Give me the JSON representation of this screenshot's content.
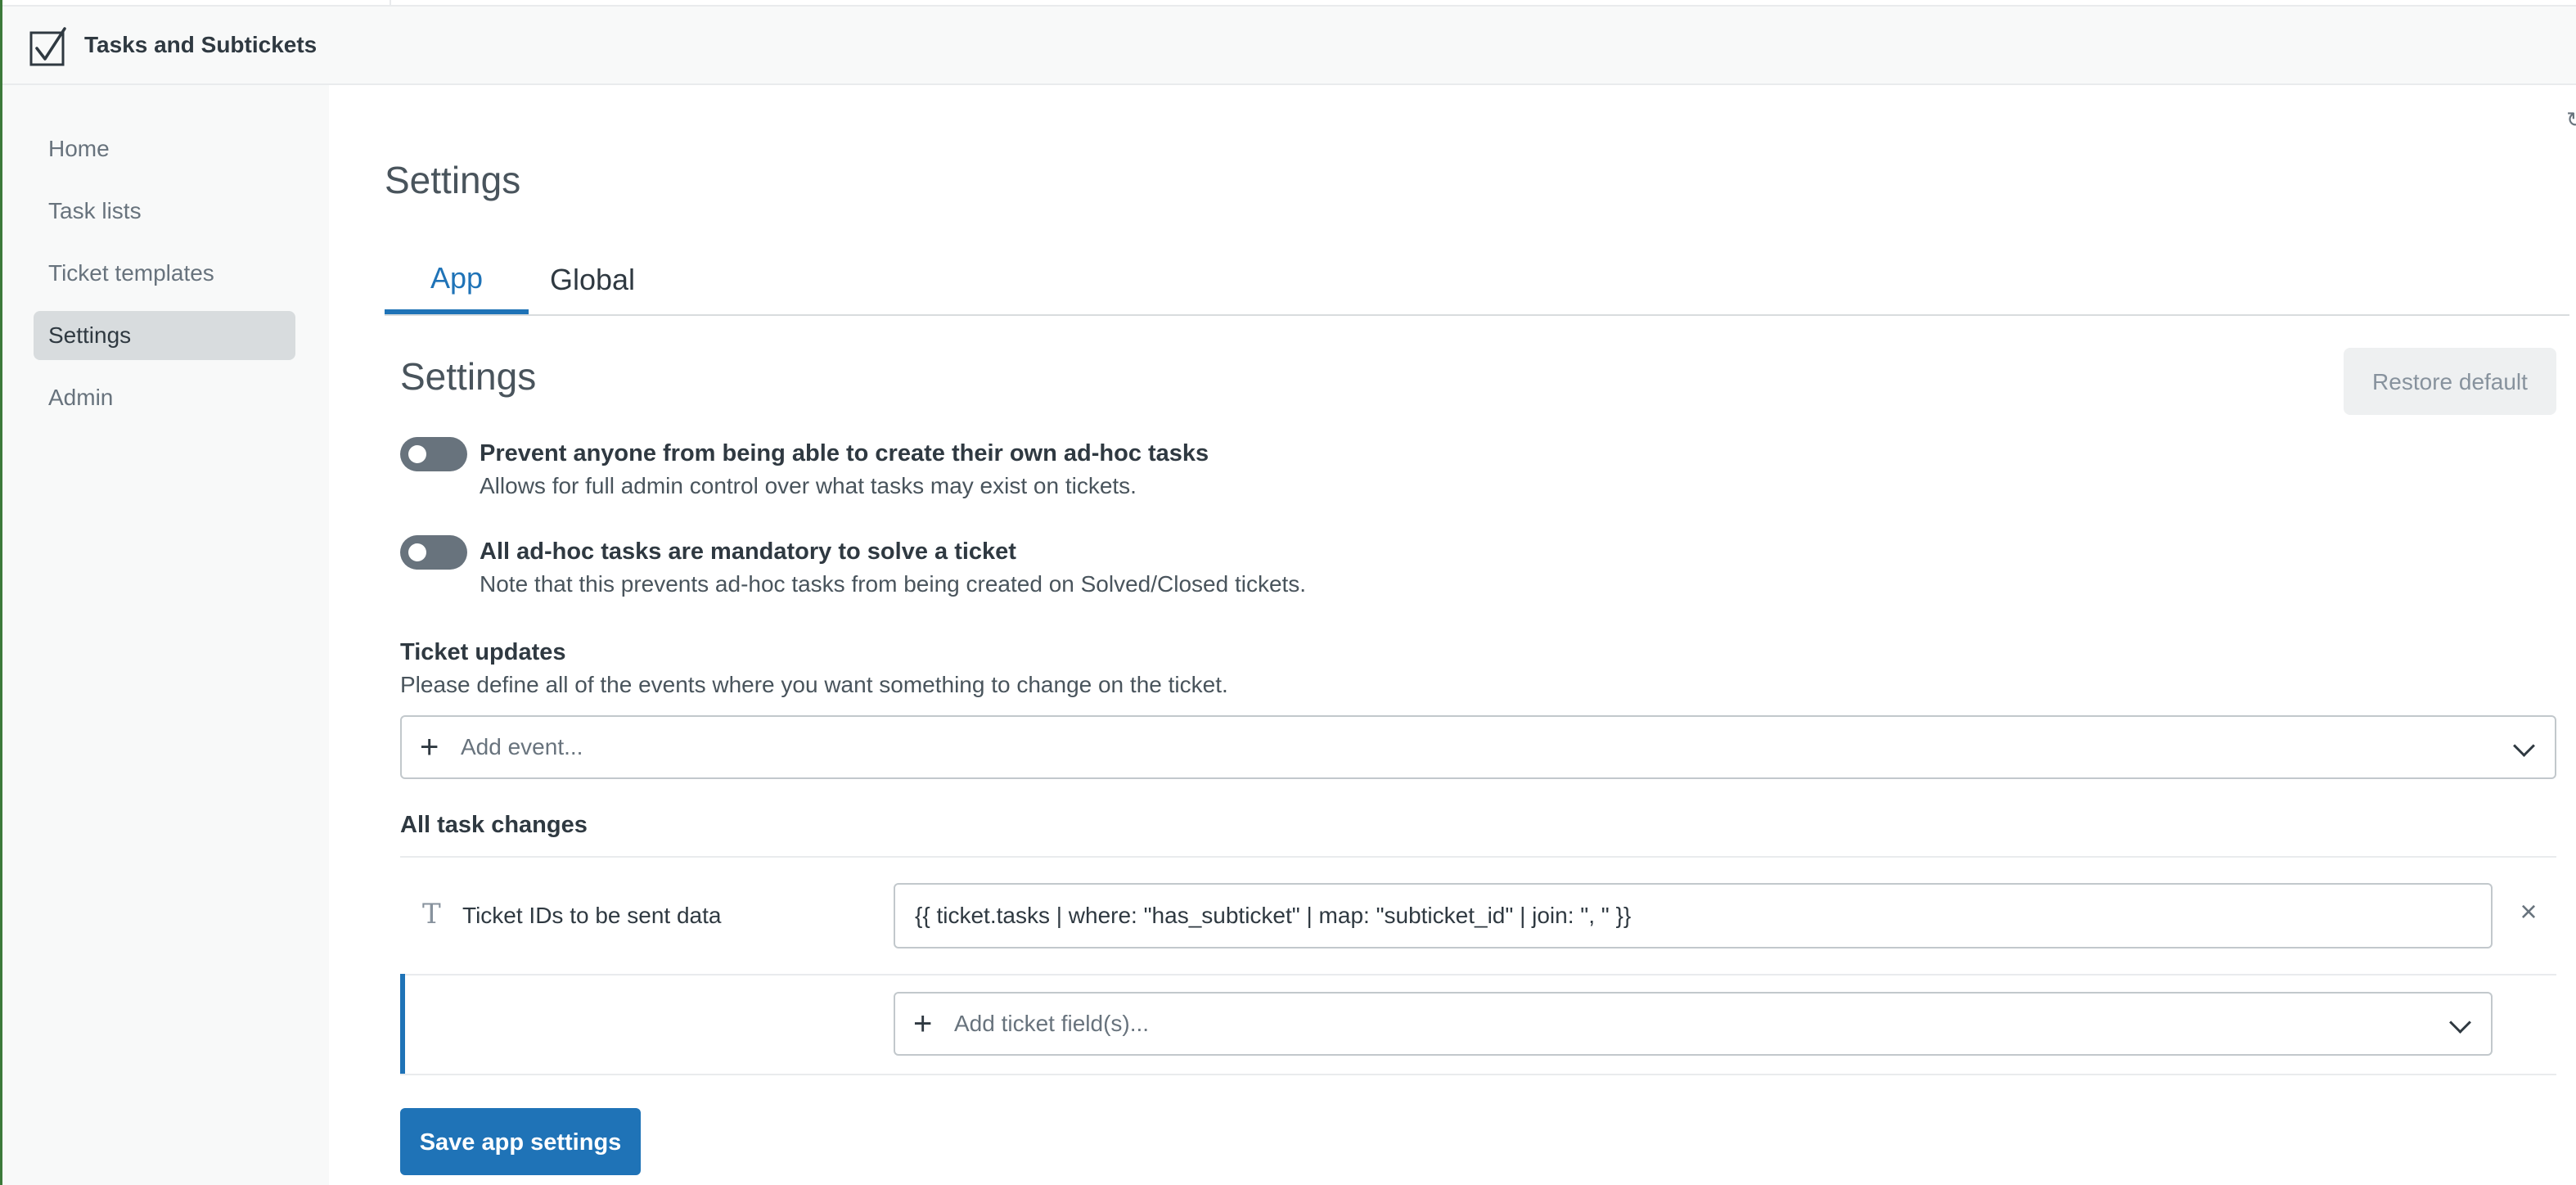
{
  "app": {
    "title": "Tasks and Subtickets",
    "logo_icon": "checkbox-icon",
    "accent_color": "#1f73b7",
    "edge_color": "#3c7a3a"
  },
  "sidebar": {
    "items": [
      {
        "label": "Home",
        "active": false
      },
      {
        "label": "Task lists",
        "active": false
      },
      {
        "label": "Ticket templates",
        "active": false
      },
      {
        "label": "Settings",
        "active": true
      },
      {
        "label": "Admin",
        "active": false
      }
    ]
  },
  "page": {
    "title": "Settings",
    "tabs": [
      {
        "label": "App",
        "active": true
      },
      {
        "label": "Global",
        "active": false
      }
    ]
  },
  "settings": {
    "title": "Settings",
    "restore_label": "Restore default",
    "toggles": [
      {
        "label": "Prevent anyone from being able to create their own ad-hoc tasks",
        "hint": "Allows for full admin control over what tasks may exist on tickets.",
        "on": false
      },
      {
        "label": "All ad-hoc tasks are mandatory to solve a ticket",
        "hint": "Note that this prevents ad-hoc tasks from being created on Solved/Closed tickets.",
        "on": false
      }
    ],
    "ticket_updates": {
      "label": "Ticket updates",
      "hint": "Please define all of the events where you want something to change on the ticket.",
      "add_event_placeholder": "Add event..."
    },
    "task_changes": {
      "label": "All task changes",
      "field_icon": "text-field-icon",
      "field_icon_glyph": "T",
      "field_name": "Ticket IDs to be sent data",
      "field_value": "{{ ticket.tasks | where: \"has_subticket\" | map: \"subticket_id\" | join: \", \" }}",
      "remove_glyph": "×",
      "add_field_placeholder": "Add ticket field(s)..."
    },
    "save_label": "Save app settings"
  }
}
